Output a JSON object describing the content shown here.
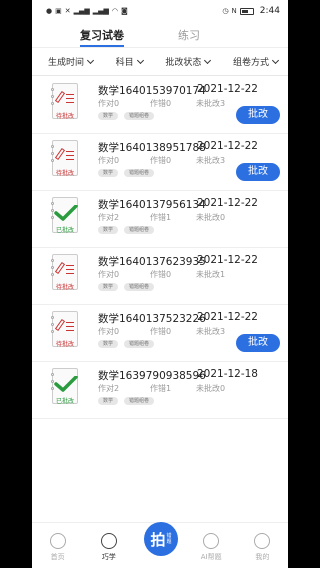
{
  "status_bar": {
    "time": "2:44",
    "left_icons": [
      "notification-icon",
      "image-icon",
      "x-icon",
      "signal-icon",
      "signal-icon",
      "wifi-icon",
      "camera-icon"
    ],
    "right_icons": [
      "alarm-icon",
      "nfc-icon",
      "battery-icon"
    ]
  },
  "tabs": [
    {
      "label": "复习试卷",
      "active": true
    },
    {
      "label": "练习",
      "active": false
    }
  ],
  "filters": [
    {
      "label": "生成时间"
    },
    {
      "label": "科目"
    },
    {
      "label": "批改状态"
    },
    {
      "label": "组卷方式"
    }
  ],
  "papers": [
    {
      "title": "数学1640153970174",
      "date": "2021-12-22",
      "status": "待批改",
      "done": false,
      "total": "作对0",
      "wrong": "作错0",
      "ungraded": "未批改3",
      "tags": [
        "数学",
        "错题组卷"
      ],
      "action": "批改"
    },
    {
      "title": "数学1640138951788",
      "date": "2021-12-22",
      "status": "待批改",
      "done": false,
      "total": "作对0",
      "wrong": "作错0",
      "ungraded": "未批改3",
      "tags": [
        "数学",
        "错题组卷"
      ],
      "action": "批改"
    },
    {
      "title": "数学1640137956134",
      "date": "2021-12-22",
      "status": "已批改",
      "done": true,
      "total": "作对2",
      "wrong": "作错1",
      "ungraded": "未批改0",
      "tags": [
        "数学",
        "错题组卷"
      ],
      "action": ""
    },
    {
      "title": "数学1640137623935",
      "date": "2021-12-22",
      "status": "待批改",
      "done": false,
      "total": "作对0",
      "wrong": "作错0",
      "ungraded": "未批改1",
      "tags": [
        "数学",
        "错题组卷"
      ],
      "action": ""
    },
    {
      "title": "数学1640137523226",
      "date": "2021-12-22",
      "status": "待批改",
      "done": false,
      "total": "作对0",
      "wrong": "作错0",
      "ungraded": "未批改3",
      "tags": [
        "数学",
        "错题组卷"
      ],
      "action": "批改"
    },
    {
      "title": "数学1639790938596",
      "date": "2021-12-18",
      "status": "已批改",
      "done": true,
      "total": "作对2",
      "wrong": "作错1",
      "ungraded": "未批改0",
      "tags": [
        "数学",
        "错题组卷"
      ],
      "action": ""
    }
  ],
  "bottom_nav": [
    {
      "label": "首页",
      "icon": "home-icon",
      "active": false
    },
    {
      "label": "巧学",
      "icon": "learn-icon",
      "active": true
    },
    {
      "label": "",
      "icon": "snap-icon",
      "active": false
    },
    {
      "label": "AI帮题",
      "icon": "ai-icon",
      "active": false
    },
    {
      "label": "我的",
      "icon": "profile-icon",
      "active": false
    }
  ],
  "snap_button": {
    "main": "拍",
    "sub_top": "错",
    "sub_bottom": "题"
  },
  "colors": {
    "accent": "#2c6fe0",
    "pending": "#cc3333",
    "done": "#2a9b3e"
  }
}
